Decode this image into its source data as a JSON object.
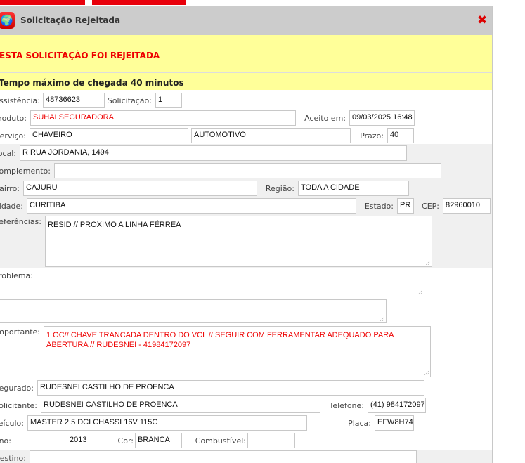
{
  "window": {
    "title": "Solicitação Rejeitada",
    "close_icon": "close-icon",
    "app_icon": "globe-icon"
  },
  "alert": {
    "message": "ESTA SOLICITAÇÃO FOI REJEITADA",
    "tempo": "Tempo máximo de chegada 40 minutos"
  },
  "fields": {
    "assistencia": {
      "label": "Assistência:",
      "value": "48736623"
    },
    "solicitacao": {
      "label": "Solicitação:",
      "value": "1"
    },
    "produto": {
      "label": "Produto:",
      "value": "SUHAI SEGURADORA"
    },
    "aceito": {
      "label": "Aceito em:",
      "value": "09/03/2025 16:48"
    },
    "servico": {
      "label": "Serviço:",
      "value": "CHAVEIRO",
      "value2": "AUTOMOTIVO"
    },
    "prazo": {
      "label": "Prazo:",
      "value": "40"
    },
    "local": {
      "label": "Local:",
      "value": "R RUA JORDANIA, 1494"
    },
    "complemento": {
      "label": "Complemento:",
      "value": ""
    },
    "bairro": {
      "label": "Bairro:",
      "value": "CAJURU"
    },
    "regiao": {
      "label": "Região:",
      "value": "TODA A CIDADE"
    },
    "cidade": {
      "label": "Cidade:",
      "value": "CURITIBA"
    },
    "estado": {
      "label": "Estado:",
      "value": "PR"
    },
    "cep": {
      "label": "CEP:",
      "value": "82960010"
    },
    "referencias": {
      "label": "Referências:",
      "value": "RESID // PROXIMO A LINHA FÉRREA"
    },
    "problema": {
      "label": "Problema:",
      "value": ""
    },
    "extra": {
      "value": ""
    },
    "importante": {
      "label": "Importante:",
      "value": "1 OC// CHAVE TRANCADA DENTRO DO VCL // SEGUIR COM FERRAMENTAR ADEQUADO PARA ABERTURA // RUDESNEI - 41984172097"
    },
    "segurado": {
      "label": "Segurado:",
      "value": "RUDESNEI CASTILHO DE PROENCA"
    },
    "solicitante": {
      "label": "Solicitante:",
      "value": "RUDESNEI CASTILHO DE PROENCA"
    },
    "telefone": {
      "label": "Telefone:",
      "value": "(41) 984172097"
    },
    "veiculo": {
      "label": "Veículo:",
      "value": "MASTER 2.5 DCI CHASSI 16V 115C"
    },
    "placa": {
      "label": "Placa:",
      "value": "EFW8H74"
    },
    "ano": {
      "label": "Ano:",
      "value": "2013"
    },
    "cor": {
      "label": "Cor:",
      "value": "BRANCA"
    },
    "combustivel": {
      "label": "Combustível:",
      "value": ""
    },
    "destino": {
      "label": "Destino:",
      "value": ""
    }
  },
  "colors": {
    "accent": "#e8000b",
    "alert_bg": "#ffff99",
    "titlebar": "#cccccc"
  }
}
